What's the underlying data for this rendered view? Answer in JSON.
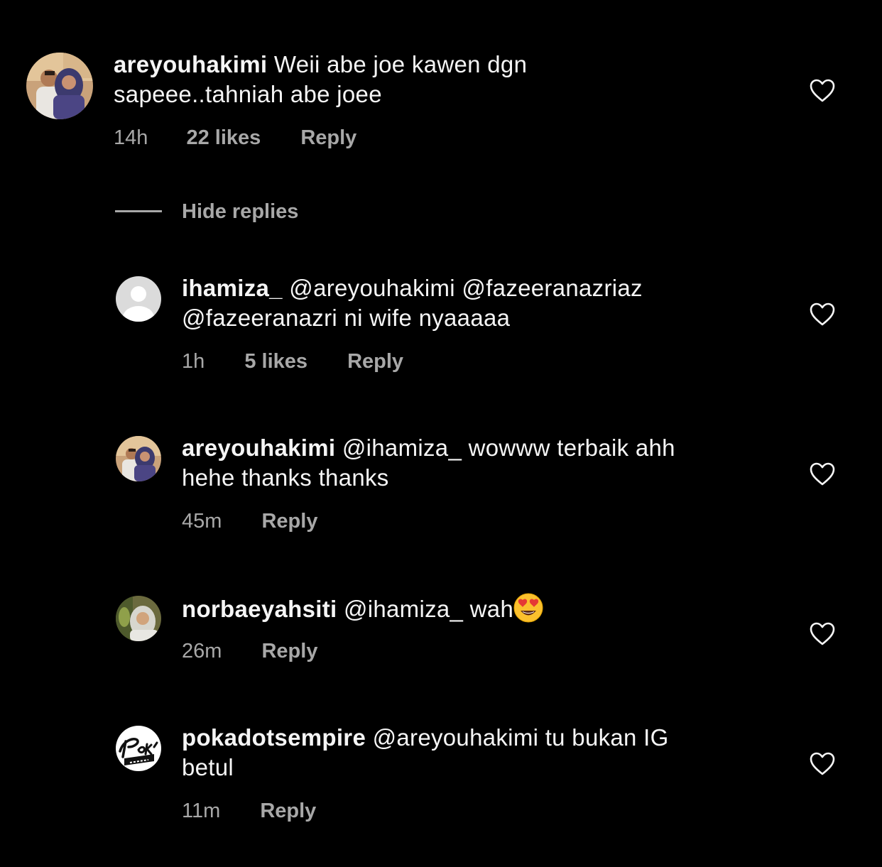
{
  "colors": {
    "background": "#000000",
    "primary_text": "#f5f5f5",
    "secondary_text": "#a8a8a8"
  },
  "comment": {
    "username": "areyouhakimi",
    "line1": "Weii abe joe kawen dgn",
    "line2": "sapeee..tahniah abe joee",
    "time": "14h",
    "likes": "22 likes",
    "reply_label": "Reply",
    "avatar_icon": "avatar-couple-photo",
    "like_icon": "heart-outline-icon"
  },
  "hide_replies_label": "Hide replies",
  "replies": [
    {
      "username": "ihamiza_",
      "line1": "@areyouhakimi @fazeeranazriaz",
      "line2": "@fazeeranazri ni wife nyaaaaa",
      "time": "1h",
      "likes": "5 likes",
      "reply_label": "Reply",
      "avatar_icon": "default-avatar-icon"
    },
    {
      "username": "areyouhakimi",
      "line1": "@ihamiza_ wowww terbaik ahh",
      "line2": "hehe thanks thanks",
      "time": "45m",
      "reply_label": "Reply",
      "avatar_icon": "avatar-couple-photo"
    },
    {
      "username": "norbaeyahsiti",
      "line1": "@ihamiza_ wah",
      "emoji": "heart-eyes-emoji",
      "time": "26m",
      "reply_label": "Reply",
      "avatar_icon": "avatar-woman-photo"
    },
    {
      "username": "pokadotsempire",
      "line1": "@areyouhakimi tu bukan IG",
      "line2": "betul",
      "time": "11m",
      "reply_label": "Reply",
      "avatar_icon": "pokad-empire-logo"
    }
  ]
}
